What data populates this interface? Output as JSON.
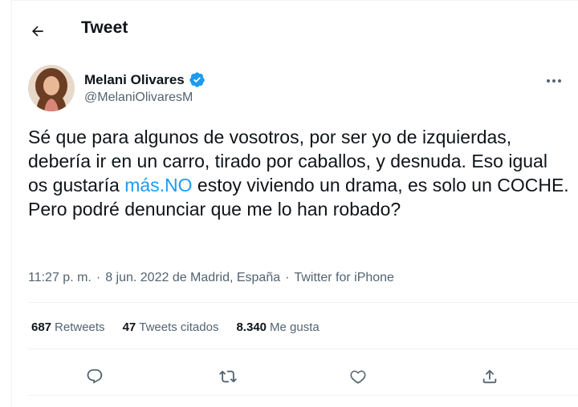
{
  "header": {
    "title": "Tweet",
    "back_icon": "arrow-left-icon"
  },
  "author": {
    "name": "Melani Olivares",
    "handle": "@MelaniOlivaresM",
    "verified_icon": "verified-badge-icon",
    "more_icon": "more-horizontal-icon"
  },
  "tweet": {
    "text_before_link": "Sé que para algunos de vosotros, por ser yo de izquierdas, debería ir en un carro, tirado por caballos, y desnuda. Eso igual os gustaría ",
    "link_text": "más.NO",
    "text_after_link": " estoy viviendo un drama, es solo un COCHE. Pero podré denunciar que me lo han robado?",
    "time": "11:27 p. m.",
    "separator1": "·",
    "date_location": "8 jun. 2022 de Madrid, España",
    "separator2": "·",
    "source": "Twitter for iPhone"
  },
  "stats": {
    "retweets_count": "687",
    "retweets_label": "Retweets",
    "quotes_count": "47",
    "quotes_label": "Tweets citados",
    "likes_count": "8.340",
    "likes_label": "Me gusta"
  },
  "actions": [
    {
      "name": "reply-icon"
    },
    {
      "name": "retweet-icon"
    },
    {
      "name": "like-icon"
    },
    {
      "name": "share-icon"
    }
  ],
  "colors": {
    "link": "#1d9bf0",
    "secondary_text": "#536471",
    "verified": "#1d9bf0"
  }
}
